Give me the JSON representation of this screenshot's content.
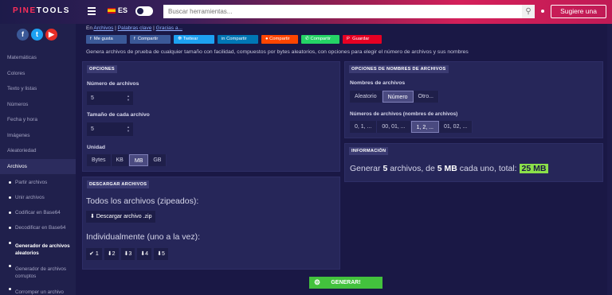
{
  "header": {
    "logo_a": "PINE",
    "logo_b": "TOOLS",
    "lang": "ES",
    "search_placeholder": "Buscar herramientas...",
    "signup": "Sugiere una"
  },
  "sidebar": {
    "items": [
      "Matemáticas",
      "Colores",
      "Texto y listas",
      "Números",
      "Fecha y hora",
      "Imágenes",
      "Aleatoriedad",
      "Archivos"
    ],
    "sub": [
      "Partir archivos",
      "Unir archivos",
      "Codificar en Base64",
      "Decodificar en Base64",
      "Generador de archivos aleatorios",
      "Generador de archivos corruptos",
      "Corromper un archivo"
    ]
  },
  "breadcrumb": {
    "prefix": "En",
    "link1": "Archivos",
    "sep": "|",
    "link2": "Palabras clave",
    "link3": "Gracias a..."
  },
  "shares": [
    "Me gusta",
    "Compartir",
    "Twitear",
    "Compartir",
    "Compartir",
    "Compartir",
    "Guardar"
  ],
  "colors": {
    "accent": "#43c23d",
    "brand": "#ff2f5a",
    "total_badge": "#8be04a"
  },
  "description": "Genera archivos de prueba de cualquier tamaño con facilidad, compuestos por bytes aleatorios, con opciones para elegir el número de archivos y sus nombres",
  "options": {
    "title": "OPCIONES",
    "num_label": "Número de archivos",
    "num_value": "5",
    "size_label": "Tamaño de cada archivo",
    "size_value": "5",
    "unit_label": "Unidad",
    "units": [
      "Bytes",
      "KB",
      "MB",
      "GB"
    ],
    "unit_selected": "MB"
  },
  "names": {
    "title": "OPCIONES DE NOMBRES DE ARCHIVOS",
    "label": "Nombres de archivos",
    "choices": [
      "Aleatorio",
      "Número",
      "Otro..."
    ],
    "choice_selected": "Número",
    "num_label": "Números de archivos (nombres de archivos)",
    "formats": [
      "0, 1, ...",
      "00, 01, ...",
      "1, 2, ...",
      "01, 02, ..."
    ],
    "format_selected": "1, 2, ..."
  },
  "info": {
    "title": "INFORMACIÓN",
    "pre": "Generar",
    "count": "5",
    "mid": "archivos, de",
    "size": "5 MB",
    "post": "cada uno, total:",
    "total": "25 MB"
  },
  "download": {
    "title": "DESCARGAR ARCHIVOS",
    "all_label": "Todos los archivos (zipeados):",
    "zip_btn": "Descargar archivo .zip",
    "ind_label": "Individualmente (uno a la vez):",
    "buttons": [
      "1",
      "2",
      "3",
      "4",
      "5"
    ]
  },
  "generate": "GENERAR!"
}
